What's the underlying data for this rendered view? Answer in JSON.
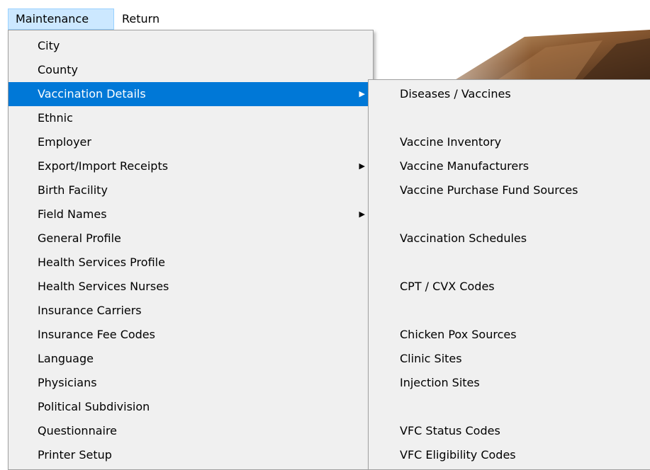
{
  "menubar": {
    "items": [
      {
        "label": "Maintenance",
        "state": "open"
      },
      {
        "label": "Return"
      }
    ]
  },
  "maintenance_menu": {
    "items": [
      {
        "label": "City"
      },
      {
        "label": "County"
      },
      {
        "label": "Vaccination Details",
        "has_submenu": true,
        "highlighted": true
      },
      {
        "label": "Ethnic"
      },
      {
        "label": "Employer"
      },
      {
        "label": "Export/Import Receipts",
        "has_submenu": true
      },
      {
        "label": "Birth Facility"
      },
      {
        "label": "Field Names",
        "has_submenu": true
      },
      {
        "label": "General Profile"
      },
      {
        "label": "Health Services Profile"
      },
      {
        "label": "Health Services Nurses"
      },
      {
        "label": "Insurance Carriers"
      },
      {
        "label": "Insurance Fee Codes"
      },
      {
        "label": "Language"
      },
      {
        "label": "Physicians"
      },
      {
        "label": "Political Subdivision"
      },
      {
        "label": "Questionnaire"
      },
      {
        "label": "Printer Setup"
      }
    ],
    "submenu_arrow_icon": "triangle-right-icon",
    "highlight_color": "#0078d7"
  },
  "vaccination_submenu": {
    "items": [
      {
        "label": "Diseases / Vaccines"
      },
      {
        "label": "Vaccine Inventory"
      },
      {
        "label": "Vaccine Manufacturers"
      },
      {
        "label": "Vaccine Purchase Fund Sources"
      },
      {
        "label": "Vaccination Schedules"
      },
      {
        "label": "CPT / CVX Codes"
      },
      {
        "label": "Chicken Pox Sources"
      },
      {
        "label": "Clinic Sites"
      },
      {
        "label": "Injection Sites"
      },
      {
        "label": "VFC Status Codes"
      },
      {
        "label": "VFC Eligibility Codes"
      }
    ]
  },
  "colors": {
    "menu_background": "#f0f0f0",
    "menubar_open_background": "#cce8ff",
    "menubar_open_border": "#99d1ff"
  }
}
